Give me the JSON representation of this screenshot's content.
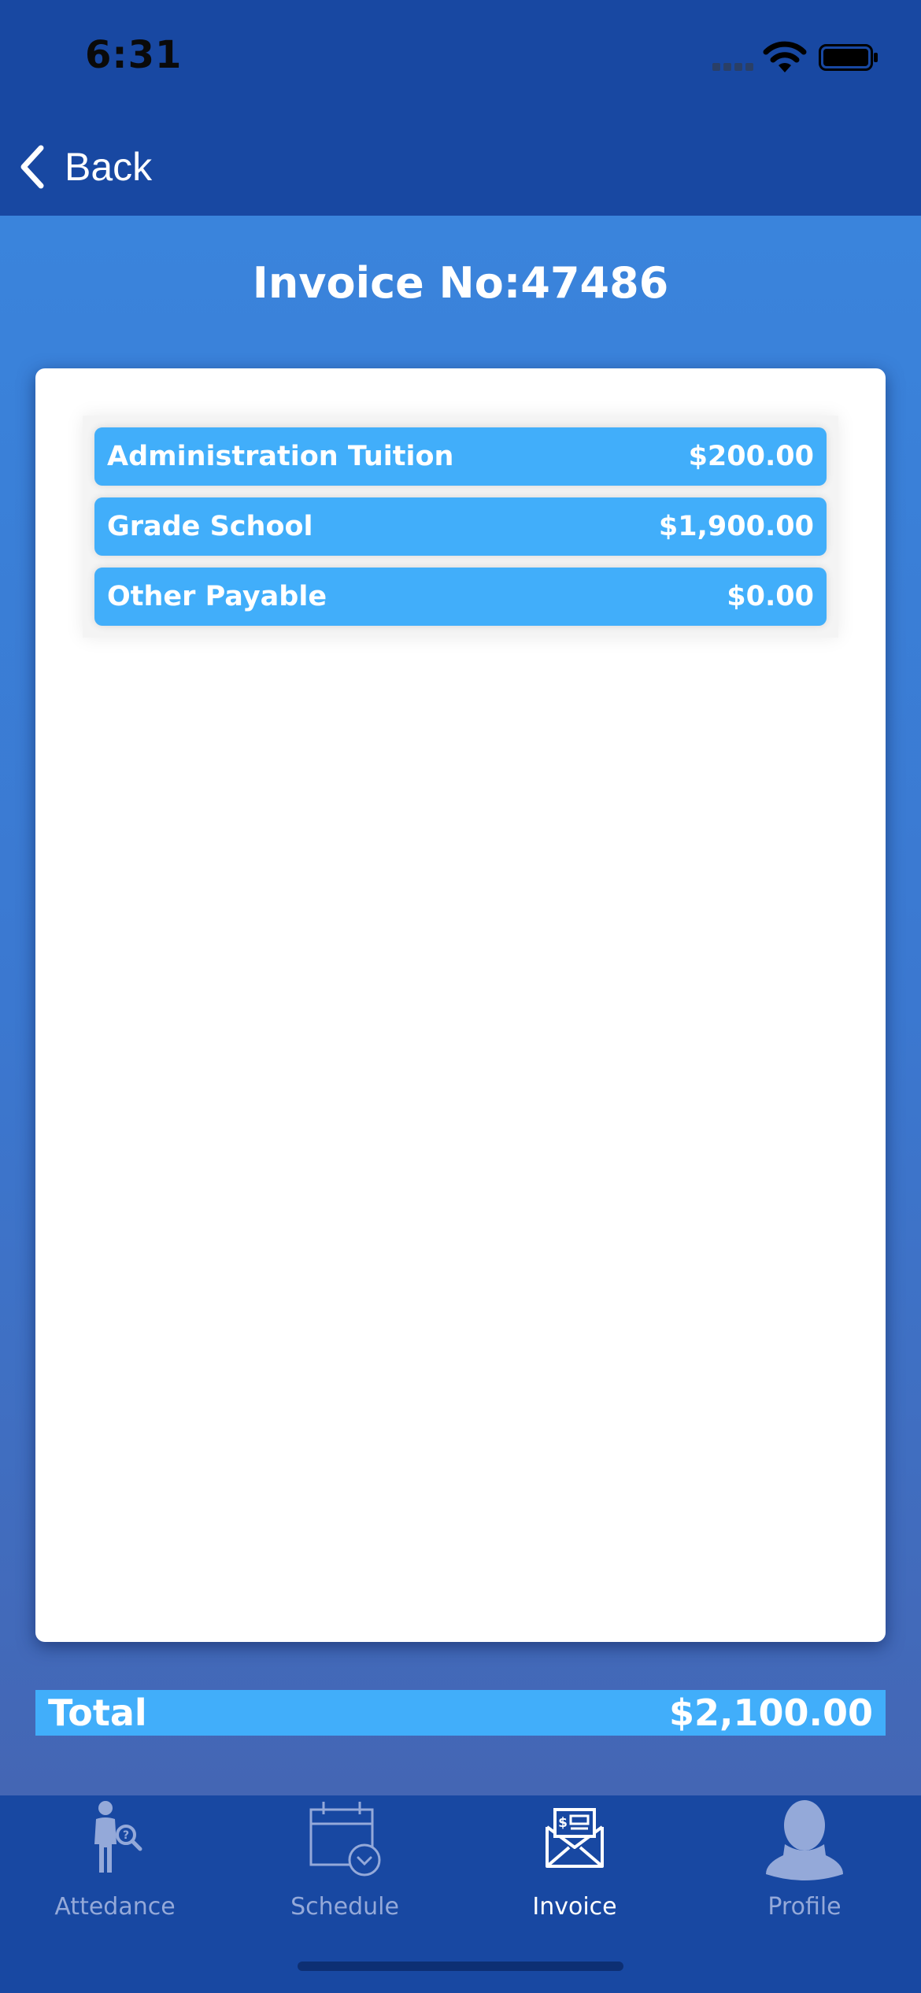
{
  "status_bar": {
    "time": "6:31"
  },
  "nav": {
    "back_label": "Back"
  },
  "invoice": {
    "title": "Invoice No:47486",
    "items": [
      {
        "label": "Administration Tuition",
        "amount": "$200.00"
      },
      {
        "label": "Grade School",
        "amount": "$1,900.00"
      },
      {
        "label": "Other Payable",
        "amount": "$0.00"
      }
    ],
    "total_label": "Total",
    "total_amount": "$2,100.00"
  },
  "tabs": [
    {
      "label": "Attedance",
      "icon": "attendance-icon",
      "active": false
    },
    {
      "label": "Schedule",
      "icon": "calendar-clock-icon",
      "active": false
    },
    {
      "label": "Invoice",
      "icon": "invoice-envelope-icon",
      "active": true
    },
    {
      "label": "Profile",
      "icon": "profile-silhouette-icon",
      "active": false
    }
  ],
  "colors": {
    "header_bg": "#1848a2",
    "item_bg": "#41aefa",
    "tab_inactive": "#94a9d9",
    "tab_active": "#ffffff"
  }
}
